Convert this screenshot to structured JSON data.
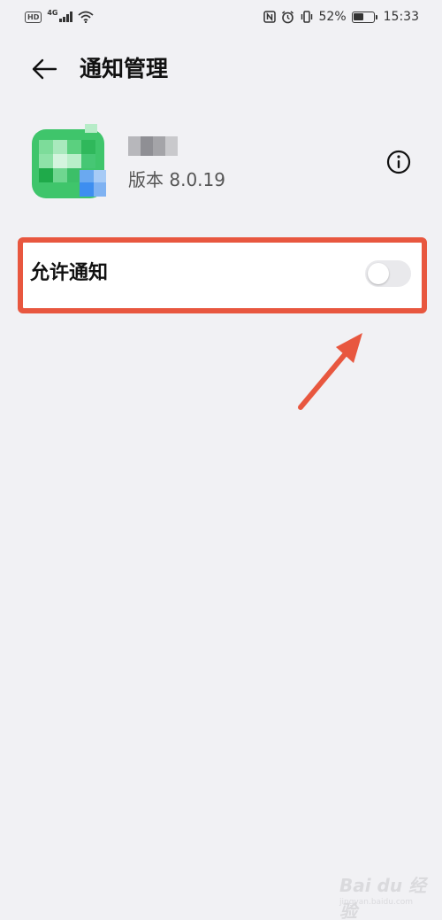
{
  "status_bar": {
    "hd": "HD",
    "network": "4G",
    "battery_percent": "52%",
    "battery_level": 0.52,
    "time": "15:33"
  },
  "header": {
    "title": "通知管理",
    "back_icon": "arrow-left-icon"
  },
  "app": {
    "name": "",
    "version": "版本 8.0.19",
    "info_icon": "info-circle-icon"
  },
  "notification": {
    "allow_label": "允许通知",
    "enabled": false
  },
  "colors": {
    "background": "#f1f1f4",
    "highlight": "#e8573f",
    "toggle_off": "#e9e9ec"
  },
  "watermark": {
    "brand": "Bai du 经验",
    "url": "jingyan.baidu.com"
  }
}
